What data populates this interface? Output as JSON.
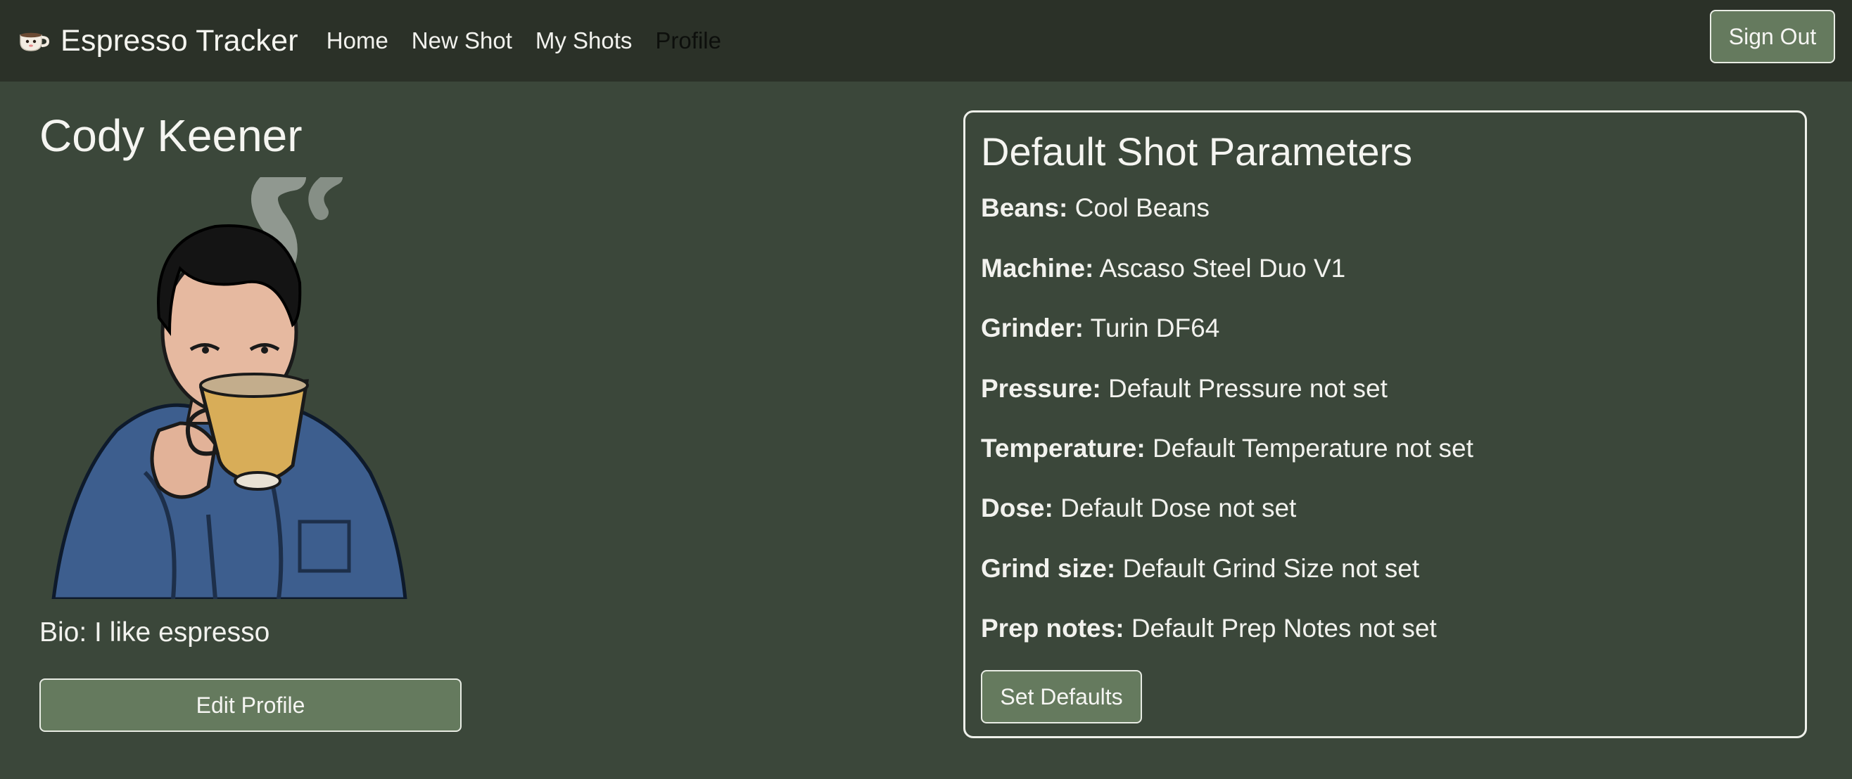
{
  "navbar": {
    "brand_icon": "coffee-cup-icon",
    "brand_text": "Espresso Tracker",
    "links": [
      {
        "label": "Home",
        "active": false
      },
      {
        "label": "New Shot",
        "active": false
      },
      {
        "label": "My Shots",
        "active": false
      },
      {
        "label": "Profile",
        "active": true
      }
    ],
    "sign_out_label": "Sign Out"
  },
  "profile": {
    "name": "Cody Keener",
    "avatar_icon": "man-drinking-coffee-illustration",
    "bio": "Bio: I like espresso",
    "edit_label": "Edit Profile"
  },
  "defaults": {
    "title": "Default Shot Parameters",
    "params": [
      {
        "label": "Beans:",
        "value": "Cool Beans"
      },
      {
        "label": "Machine:",
        "value": "Ascaso Steel Duo V1"
      },
      {
        "label": "Grinder:",
        "value": "Turin DF64"
      },
      {
        "label": "Pressure:",
        "value": "Default Pressure not set"
      },
      {
        "label": "Temperature:",
        "value": "Default Temperature not set"
      },
      {
        "label": "Dose:",
        "value": "Default Dose not set"
      },
      {
        "label": "Grind size:",
        "value": "Default Grind Size not set"
      },
      {
        "label": "Prep notes:",
        "value": "Default Prep Notes not set"
      }
    ],
    "set_defaults_label": "Set Defaults"
  },
  "colors": {
    "page_background": "#3b473a",
    "navbar_background": "#2b3128",
    "button_background": "#657a5e",
    "border": "#eef0ea"
  }
}
